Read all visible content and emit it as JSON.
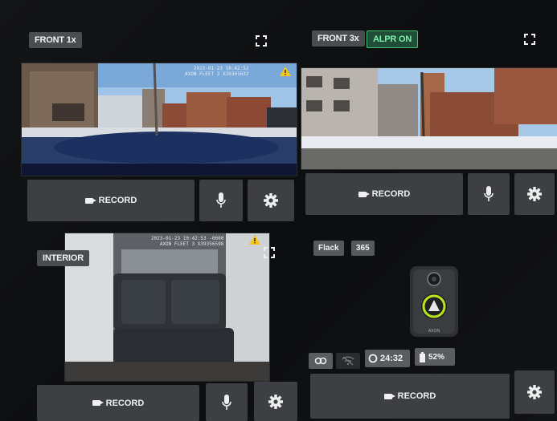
{
  "cameras": {
    "front1x": {
      "label": "FRONT 1x",
      "timestamp_line1": "2023-01-23 10:42:52",
      "timestamp_line2": "AXON FLEET 3 X39301632",
      "record_label": "RECORD"
    },
    "front3x": {
      "label": "FRONT 3x",
      "alpr_label": "ALPR ON",
      "record_label": "RECORD"
    },
    "interior": {
      "label": "INTERIOR",
      "timestamp_line1": "2023-01-23 10:42:53 -0600",
      "timestamp_line2": "AXON FLEET 3 X39356598",
      "record_label": "RECORD"
    }
  },
  "body_cam": {
    "name_label": "Flack",
    "id_label": "365",
    "brand": "AXON",
    "elapsed": "24:32",
    "battery": "52%",
    "record_label": "RECORD"
  },
  "colors": {
    "accent_green": "#3cc07a",
    "warning": "#f5c518",
    "button_bg": "#3d3f43"
  },
  "icons": [
    "fullscreen-icon",
    "camera-icon",
    "microphone-icon",
    "gear-icon",
    "warning-icon",
    "link-icon",
    "wifi-off-icon",
    "timer-icon",
    "battery-icon"
  ]
}
